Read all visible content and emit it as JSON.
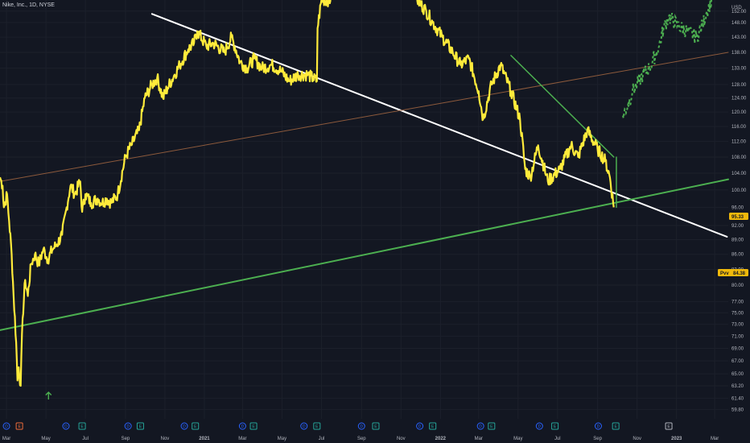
{
  "symbol_label": "Nike, Inc., 1D, NYSE",
  "currency_label": "USD",
  "colors": {
    "background": "#131722",
    "price_line": "#ffeb3b",
    "green_trend": "#4caf50",
    "white_trend": "#ffffff",
    "brown_trend": "#8d5a3c",
    "projection": "#4caf50",
    "badge_bg": "#f0b90b",
    "dividend": "#2962ff",
    "earnings": "#26a69a",
    "split": "#ef6c3a"
  },
  "price_badge": "95.33",
  "pivot_badge": {
    "label": "Pvv",
    "value": "84.38"
  },
  "chart_data": {
    "type": "line",
    "title": "",
    "ylabel": "USD",
    "y_scale": "log",
    "ylim": [
      58.5,
      156
    ],
    "xlim": [
      "2020-02-20",
      "2023-03-22"
    ],
    "y_ticks": [
      "152.00",
      "148.00",
      "143.00",
      "138.00",
      "133.00",
      "128.00",
      "124.00",
      "120.00",
      "116.00",
      "112.00",
      "108.00",
      "104.00",
      "100.00",
      "96.00",
      "92.00",
      "89.00",
      "86.00",
      "83.00",
      "80.00",
      "77.00",
      "75.00",
      "73.00",
      "71.00",
      "69.00",
      "67.00",
      "65.00",
      "63.20",
      "61.40",
      "59.80"
    ],
    "x_ticks": [
      {
        "label": "Mar",
        "date": "2020-03-01"
      },
      {
        "label": "May",
        "date": "2020-05-01"
      },
      {
        "label": "Jul",
        "date": "2020-07-01"
      },
      {
        "label": "Sep",
        "date": "2020-09-01"
      },
      {
        "label": "Nov",
        "date": "2020-11-01"
      },
      {
        "label": "2021",
        "date": "2021-01-01"
      },
      {
        "label": "Mar",
        "date": "2021-03-01"
      },
      {
        "label": "May",
        "date": "2021-05-01"
      },
      {
        "label": "Jul",
        "date": "2021-07-01"
      },
      {
        "label": "Sep",
        "date": "2021-09-01"
      },
      {
        "label": "Nov",
        "date": "2021-11-01"
      },
      {
        "label": "2022",
        "date": "2022-01-01"
      },
      {
        "label": "Mar",
        "date": "2022-03-01"
      },
      {
        "label": "May",
        "date": "2022-05-01"
      },
      {
        "label": "Jul",
        "date": "2022-07-01"
      },
      {
        "label": "Sep",
        "date": "2022-09-01"
      },
      {
        "label": "Nov",
        "date": "2022-11-01"
      },
      {
        "label": "2023",
        "date": "2023-01-01"
      },
      {
        "label": "Mar",
        "date": "2023-03-01"
      }
    ],
    "series": [
      {
        "kind": "price",
        "points": [
          [
            "2020-02-20",
            103
          ],
          [
            "2020-02-24",
            101
          ],
          [
            "2020-02-26",
            96
          ],
          [
            "2020-03-02",
            99
          ],
          [
            "2020-03-05",
            93
          ],
          [
            "2020-03-09",
            86
          ],
          [
            "2020-03-12",
            78
          ],
          [
            "2020-03-16",
            70
          ],
          [
            "2020-03-18",
            64
          ],
          [
            "2020-03-20",
            66
          ],
          [
            "2020-03-23",
            63.2
          ],
          [
            "2020-03-26",
            74
          ],
          [
            "2020-03-30",
            81
          ],
          [
            "2020-04-03",
            78
          ],
          [
            "2020-04-08",
            84
          ],
          [
            "2020-04-14",
            86
          ],
          [
            "2020-04-20",
            84
          ],
          [
            "2020-04-27",
            87
          ],
          [
            "2020-05-04",
            85
          ],
          [
            "2020-05-11",
            87
          ],
          [
            "2020-05-18",
            88
          ],
          [
            "2020-05-26",
            90
          ],
          [
            "2020-06-02",
            96
          ],
          [
            "2020-06-08",
            101
          ],
          [
            "2020-06-15",
            99
          ],
          [
            "2020-06-23",
            102
          ],
          [
            "2020-06-26",
            95
          ],
          [
            "2020-07-01",
            99
          ],
          [
            "2020-07-10",
            97
          ],
          [
            "2020-07-20",
            98
          ],
          [
            "2020-07-27",
            97
          ],
          [
            "2020-08-03",
            98
          ],
          [
            "2020-08-10",
            97
          ],
          [
            "2020-08-20",
            99
          ],
          [
            "2020-09-01",
            108
          ],
          [
            "2020-09-10",
            111
          ],
          [
            "2020-09-22",
            115
          ],
          [
            "2020-10-01",
            124
          ],
          [
            "2020-10-12",
            128
          ],
          [
            "2020-10-20",
            130
          ],
          [
            "2020-10-29",
            124
          ],
          [
            "2020-11-05",
            127
          ],
          [
            "2020-11-16",
            131
          ],
          [
            "2020-11-24",
            134
          ],
          [
            "2020-12-07",
            139
          ],
          [
            "2020-12-16",
            141
          ],
          [
            "2020-12-21",
            145
          ],
          [
            "2021-01-04",
            140
          ],
          [
            "2021-01-15",
            141
          ],
          [
            "2021-02-01",
            138
          ],
          [
            "2021-02-12",
            143
          ],
          [
            "2021-02-25",
            135
          ],
          [
            "2021-03-08",
            133
          ],
          [
            "2021-03-19",
            136
          ],
          [
            "2021-03-31",
            133
          ],
          [
            "2021-04-15",
            134
          ],
          [
            "2021-04-30",
            132
          ],
          [
            "2021-05-12",
            129
          ],
          [
            "2021-05-26",
            131
          ],
          [
            "2021-06-10",
            131
          ],
          [
            "2021-06-24",
            129
          ],
          [
            "2021-06-25",
            146
          ],
          [
            "2021-07-01",
            156
          ],
          [
            "2021-07-15",
            156
          ]
        ]
      },
      {
        "kind": "price",
        "points": [
          [
            "2021-11-26",
            156
          ],
          [
            "2021-12-10",
            152
          ],
          [
            "2021-12-20",
            148
          ],
          [
            "2022-01-04",
            143
          ],
          [
            "2022-01-20",
            138
          ],
          [
            "2022-02-01",
            134
          ],
          [
            "2022-02-14",
            136
          ],
          [
            "2022-03-01",
            126
          ],
          [
            "2022-03-08",
            118
          ],
          [
            "2022-03-21",
            128
          ],
          [
            "2022-04-04",
            134
          ],
          [
            "2022-04-20",
            126
          ],
          [
            "2022-05-04",
            118
          ],
          [
            "2022-05-12",
            105
          ],
          [
            "2022-05-20",
            103
          ],
          [
            "2022-06-01",
            111
          ],
          [
            "2022-06-16",
            102
          ],
          [
            "2022-07-05",
            105
          ],
          [
            "2022-07-22",
            111
          ],
          [
            "2022-08-02",
            108
          ],
          [
            "2022-08-16",
            115
          ],
          [
            "2022-09-01",
            110
          ],
          [
            "2022-09-13",
            107
          ],
          [
            "2022-09-20",
            103
          ],
          [
            "2022-09-26",
            96
          ]
        ]
      }
    ],
    "trendlines": [
      {
        "kind": "white",
        "from": [
          "2020-10-12",
          151
        ],
        "to": [
          "2023-03-20",
          89.6
        ]
      },
      {
        "kind": "green",
        "from": [
          "2020-02-20",
          72
        ],
        "to": [
          "2023-03-22",
          102.5
        ]
      },
      {
        "kind": "brown",
        "from": [
          "2020-02-20",
          102
        ],
        "to": [
          "2023-03-22",
          138
        ]
      },
      {
        "kind": "green_short",
        "from": [
          "2022-04-20",
          137
        ],
        "to": [
          "2022-09-26",
          108
        ]
      },
      {
        "kind": "green_bar",
        "from": [
          "2022-09-30",
          96
        ],
        "to": [
          "2022-09-30",
          108
        ]
      }
    ],
    "projection": {
      "kind": "green_dashed",
      "points": [
        [
          "2022-10-10",
          119
        ],
        [
          "2022-10-18",
          122
        ],
        [
          "2022-10-25",
          126
        ],
        [
          "2022-11-01",
          128
        ],
        [
          "2022-11-10",
          131
        ],
        [
          "2022-11-20",
          133
        ],
        [
          "2022-11-29",
          137
        ],
        [
          "2022-12-05",
          140
        ],
        [
          "2022-12-12",
          146
        ],
        [
          "2022-12-20",
          150
        ],
        [
          "2023-01-03",
          147
        ],
        [
          "2023-01-17",
          145
        ],
        [
          "2023-02-01",
          143
        ],
        [
          "2023-02-10",
          147
        ],
        [
          "2023-02-17",
          152
        ],
        [
          "2023-02-24",
          156
        ]
      ]
    },
    "events": [
      {
        "date": "2020-03-01",
        "type": "D"
      },
      {
        "date": "2020-03-21",
        "type": "E"
      },
      {
        "date": "2020-06-01",
        "type": "D"
      },
      {
        "date": "2020-06-26",
        "type": "E"
      },
      {
        "date": "2020-09-05",
        "type": "D"
      },
      {
        "date": "2020-09-24",
        "type": "E"
      },
      {
        "date": "2020-12-01",
        "type": "D"
      },
      {
        "date": "2020-12-18",
        "type": "E"
      },
      {
        "date": "2021-03-01",
        "type": "D"
      },
      {
        "date": "2021-03-18",
        "type": "E"
      },
      {
        "date": "2021-06-04",
        "type": "D"
      },
      {
        "date": "2021-06-24",
        "type": "E"
      },
      {
        "date": "2021-09-01",
        "type": "D"
      },
      {
        "date": "2021-09-23",
        "type": "E"
      },
      {
        "date": "2021-11-30",
        "type": "D"
      },
      {
        "date": "2021-12-20",
        "type": "E"
      },
      {
        "date": "2022-03-04",
        "type": "D"
      },
      {
        "date": "2022-03-21",
        "type": "E"
      },
      {
        "date": "2022-06-03",
        "type": "D"
      },
      {
        "date": "2022-06-27",
        "type": "E"
      },
      {
        "date": "2022-09-02",
        "type": "D"
      },
      {
        "date": "2022-09-29",
        "type": "E"
      },
      {
        "date": "2022-12-20",
        "type": "E"
      }
    ],
    "arrow_marker": {
      "date": "2020-05-05",
      "direction": "up"
    }
  }
}
